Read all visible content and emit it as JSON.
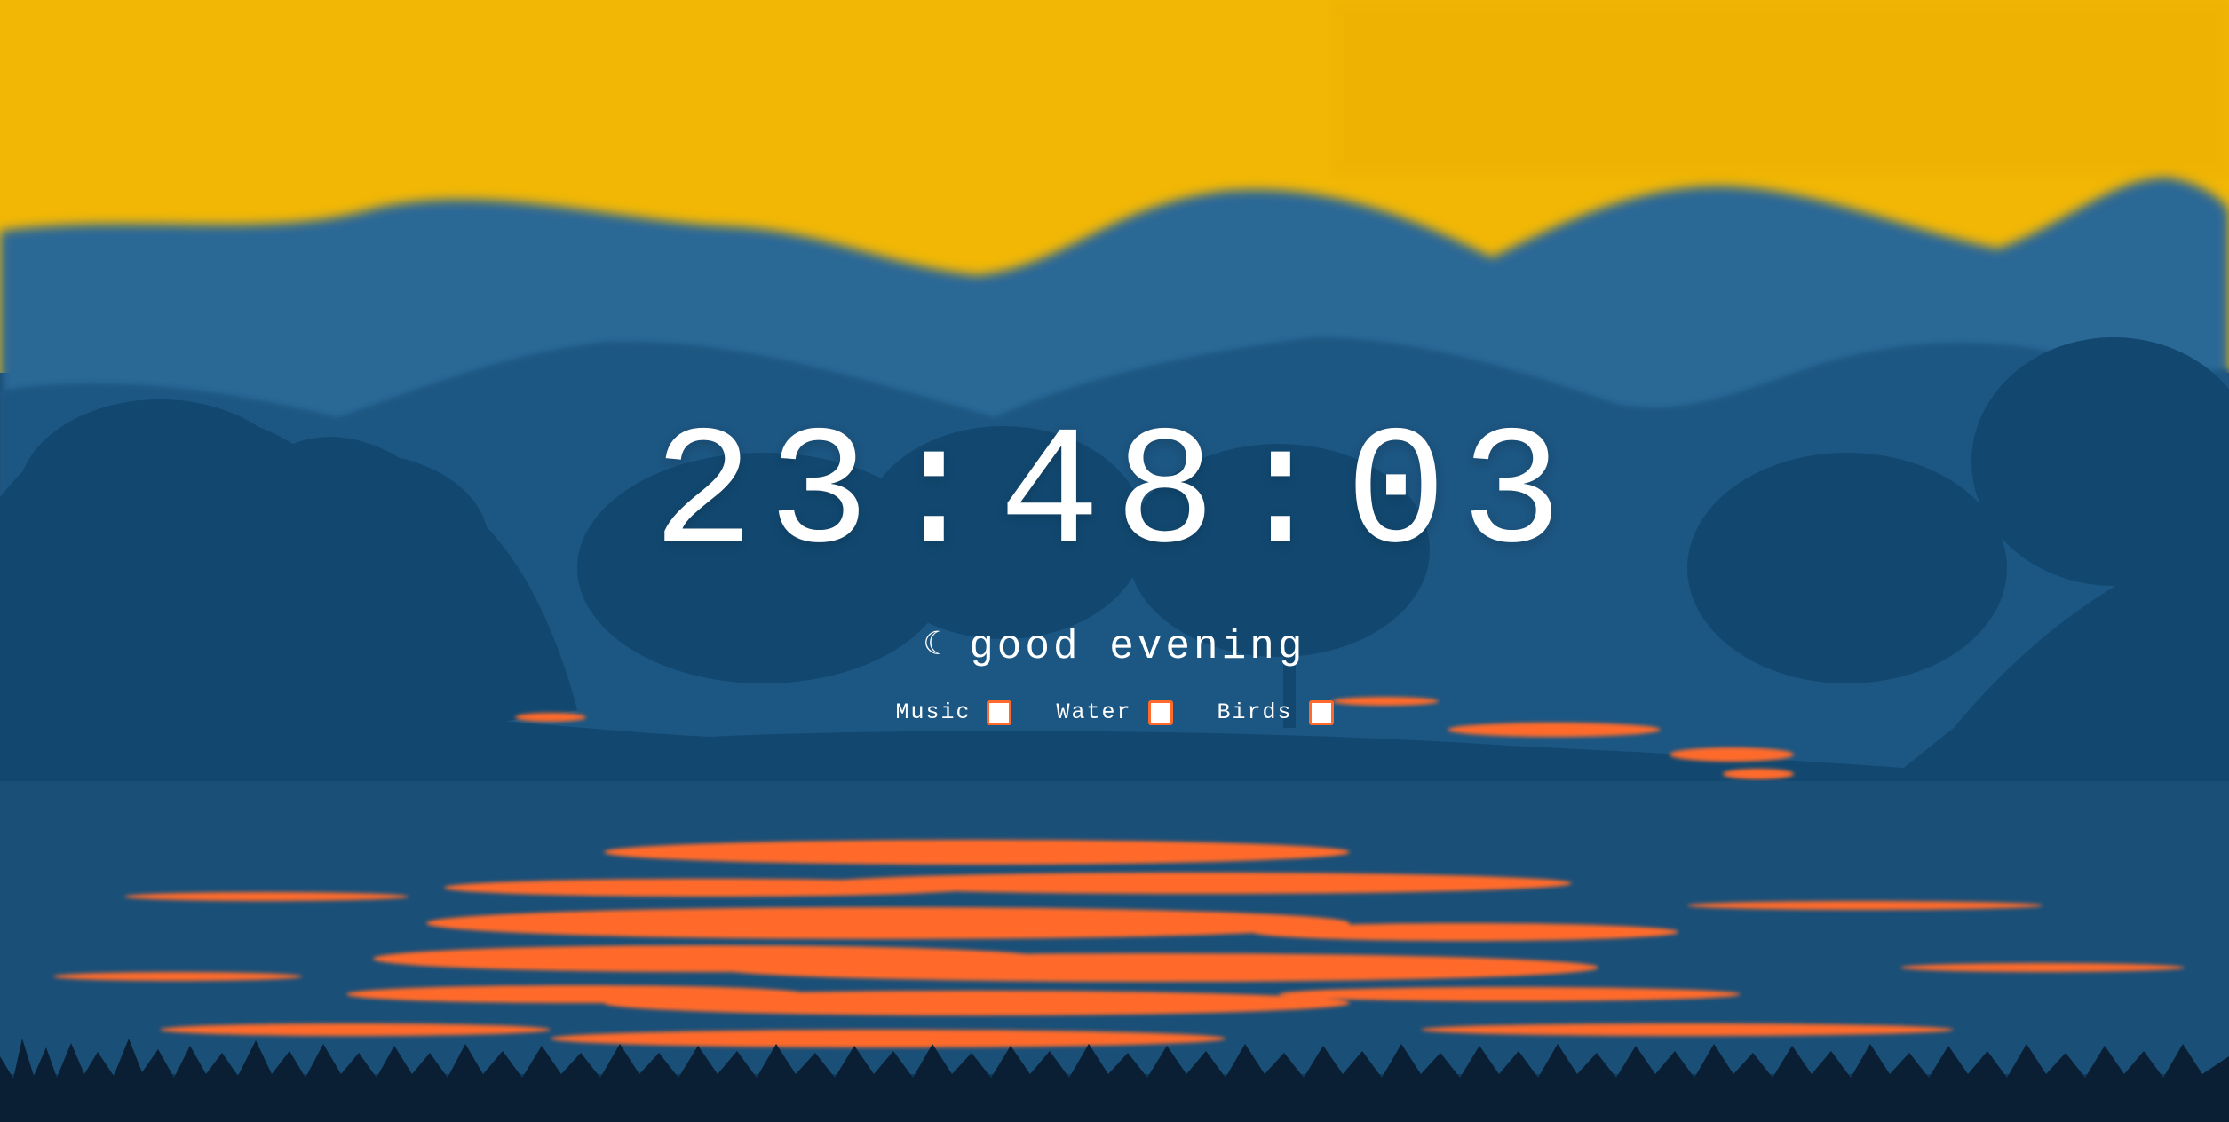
{
  "clock": {
    "time": "23:48:03"
  },
  "greeting": {
    "icon": "moon-icon",
    "icon_glyph": "☾",
    "text": "good evening"
  },
  "sound_toggles": [
    {
      "label": "Music",
      "checked": false
    },
    {
      "label": "Water",
      "checked": false
    },
    {
      "label": "Birds",
      "checked": false
    }
  ],
  "colors": {
    "sky": "#f2b705",
    "far_hills": "#2c6896",
    "mid_hills": "#1a5682",
    "trees": "#124870",
    "water": "#1a4f78",
    "reflection": "#ff6a2c",
    "grass": "#0a1f33",
    "checkbox_border": "#ff6a2c"
  }
}
